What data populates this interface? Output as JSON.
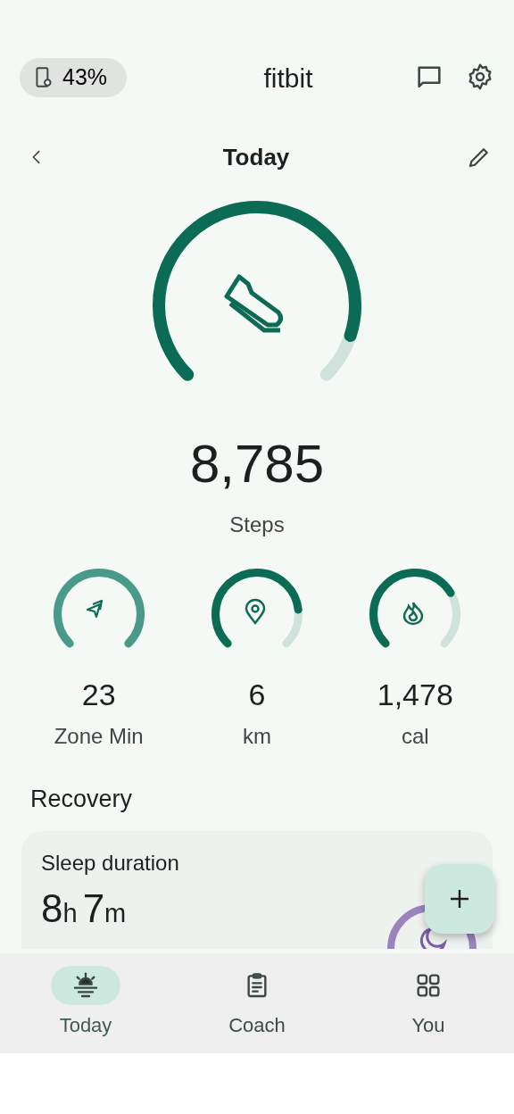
{
  "header": {
    "battery": "43%",
    "title": "fitbit"
  },
  "date_bar": {
    "title": "Today"
  },
  "steps": {
    "value": "8,785",
    "label": "Steps"
  },
  "metrics": [
    {
      "kind": "zone",
      "value": "23",
      "label": "Zone Min"
    },
    {
      "kind": "distance",
      "value": "6",
      "label": "km"
    },
    {
      "kind": "calories",
      "value": "1,478",
      "label": "cal"
    }
  ],
  "section_title": "Recovery",
  "sleep_card": {
    "title": "Sleep duration",
    "hours": "8",
    "hours_unit": "h",
    "minutes": "7",
    "minutes_unit": "m"
  },
  "nav": [
    {
      "label": "Today",
      "selected": true
    },
    {
      "label": "Coach",
      "selected": false
    },
    {
      "label": "You",
      "selected": false
    }
  ]
}
